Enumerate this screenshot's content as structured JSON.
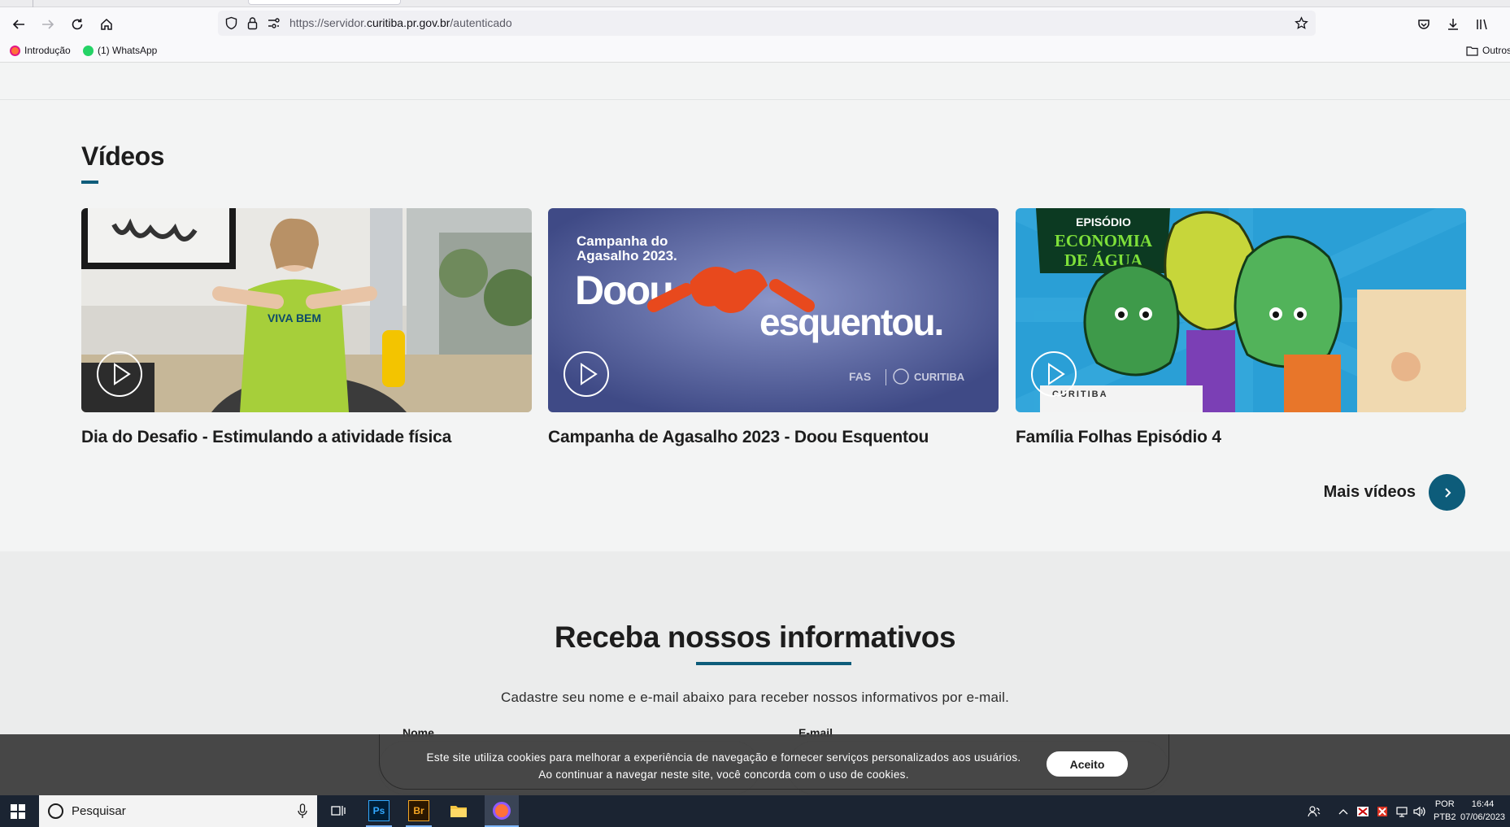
{
  "browser": {
    "url_prefix": "https://servidor.",
    "url_host": "curitiba.pr.gov.br",
    "url_path": "/autenticado",
    "bookmarks": [
      {
        "label": "Introdução"
      },
      {
        "label": "(1) WhatsApp"
      }
    ],
    "other_bookmarks": "Outros"
  },
  "videos": {
    "title": "Vídeos",
    "items": [
      {
        "title": "Dia do Desafio - Estimulando a atividade física",
        "shirt_text": "VIVA BEM"
      },
      {
        "title": "Campanha de Agasalho 2023 - Doou Esquentou",
        "banner_line1": "Campanha do",
        "banner_line2": "Agasalho 2023.",
        "banner_word1": "Doou",
        "banner_word2": "esquentou.",
        "banner_logo1": "FAS",
        "banner_logo2": "CURITIBA"
      },
      {
        "title": "Família Folhas Episódio 4",
        "sign_top": "EPISÓDIO",
        "sign_line1": "ECONOMIA",
        "sign_line2": "DE ÁGUA",
        "poster_text": "CURITIBA"
      }
    ],
    "more_label": "Mais vídeos"
  },
  "newsletter": {
    "title": "Receba nossos informativos",
    "subtitle": "Cadastre seu nome e e-mail abaixo para receber nossos informativos por e-mail.",
    "name_label": "Nome",
    "email_label": "E-mail"
  },
  "cookie": {
    "line1": "Este site utiliza cookies para melhorar a experiência de navegação e fornecer serviços personalizados aos usuários.",
    "line2": "Ao continuar a navegar neste site, você concorda com o uso de cookies.",
    "accept_label": "Aceito"
  },
  "taskbar": {
    "search_placeholder": "Pesquisar",
    "apps": [
      "Ps",
      "Br"
    ],
    "lang_top": "POR",
    "lang_bottom": "PTB2",
    "time": "16:44",
    "date": "07/06/2023"
  },
  "colors": {
    "accent": "#0d5c7a",
    "taskbar": "#1b2432"
  }
}
